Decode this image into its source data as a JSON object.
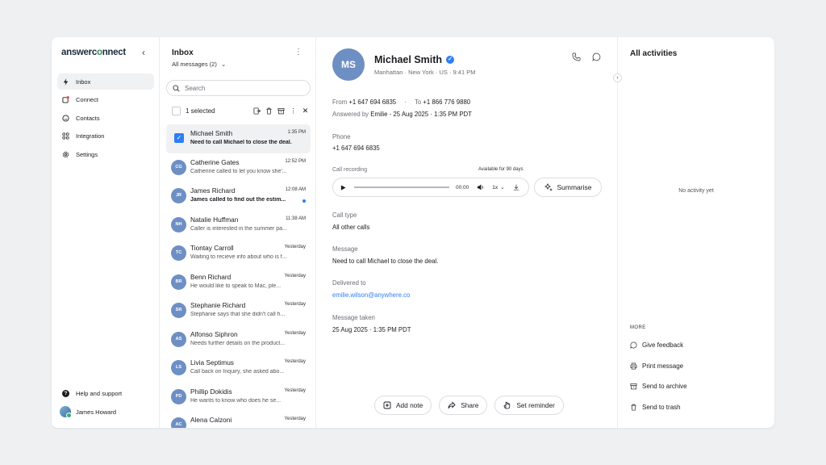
{
  "sidebar": {
    "logo": "answerconnect",
    "collapse_icon": "chevron-left-icon",
    "items": [
      {
        "label": "Inbox",
        "icon": "lightning-icon",
        "active": true
      },
      {
        "label": "Connect",
        "icon": "connect-icon"
      },
      {
        "label": "Contacts",
        "icon": "smile-icon"
      },
      {
        "label": "Integration",
        "icon": "grid-icon"
      },
      {
        "label": "Settings",
        "icon": "gear-icon"
      }
    ],
    "help_label": "Help and support",
    "user_name": "James Howard"
  },
  "inbox": {
    "title": "Inbox",
    "filter_label": "All messages (2)",
    "search_placeholder": "Search",
    "selected_label": "1 selected",
    "messages": [
      {
        "initials": "",
        "name": "Michael Smith",
        "time": "1:35 PM",
        "preview": "Need to call Michael to close the deal.",
        "selected": true,
        "unread": true
      },
      {
        "initials": "CG",
        "name": "Catherine Gates",
        "time": "12:52 PM",
        "preview": "Catherine called to let you know she'..."
      },
      {
        "initials": "JR",
        "name": "James Richard",
        "time": "12:08 AM",
        "preview": "James called to find out the estim...",
        "unread": true
      },
      {
        "initials": "NH",
        "name": "Natalie Huffman",
        "time": "11:38 AM",
        "preview": "Caller is interested in the summer pa..."
      },
      {
        "initials": "TC",
        "name": "Tiontay Carroll",
        "time": "Yesterday",
        "preview": "Waiting to recieve info about who is f..."
      },
      {
        "initials": "BR",
        "name": "Benn Richard",
        "time": "Yesterday",
        "preview": "He would like to speak to Mac, ple..."
      },
      {
        "initials": "SR",
        "name": "Stephanie Richard",
        "time": "Yesterday",
        "preview": "Stephanie says that she didn't call h..."
      },
      {
        "initials": "AS",
        "name": "Alfonso Siphron",
        "time": "Yesterday",
        "preview": "Needs further details on the product..."
      },
      {
        "initials": "LS",
        "name": "Livia Septimus",
        "time": "Yesterday",
        "preview": "Call back on Inquiry, she asked abo..."
      },
      {
        "initials": "PD",
        "name": "Phillip Dokidis",
        "time": "Yesterday",
        "preview": "He wants to know who does he se..."
      },
      {
        "initials": "AC",
        "name": "Alena Calzoni",
        "time": "Yesterday",
        "preview": "..."
      }
    ]
  },
  "detail": {
    "initials": "MS",
    "name": "Michael Smith",
    "location": "Manhattan · New York · US · 9:41 PM",
    "from_label": "From",
    "from_number": "+1 647 694 6835",
    "to_label": "To",
    "to_number": "+1 866 776 9880",
    "answered_label": "Answered by",
    "answered_value": "Emilie - 25 Aug 2025 · 1:35 PM PDT",
    "phone_label": "Phone",
    "phone_value": "+1 647 694 6835",
    "recording_label": "Call recording",
    "availability": "Available for 90 days",
    "player_time": "00:00",
    "speed": "1x",
    "summarise_label": "Summarise",
    "call_type_label": "Call type",
    "call_type_value": "All other calls",
    "message_label": "Message",
    "message_value": "Need to call Michael to close the deal.",
    "delivered_label": "Delivered to",
    "delivered_value": "emilie.wilson@anywhere.co",
    "taken_label": "Message taken",
    "taken_value": "25 Aug 2025 · 1:35 PM PDT",
    "actions": {
      "add_note": "Add note",
      "share": "Share",
      "reminder": "Set reminder"
    }
  },
  "activity": {
    "title": "All activities",
    "empty": "No activity yet",
    "more_label": "MORE",
    "feedback": "Give feedback",
    "print": "Print message",
    "archive": "Send to archive",
    "trash": "Send to trash"
  },
  "colors": {
    "accent": "#2d7df6",
    "avatar": "#6e8fc4"
  }
}
